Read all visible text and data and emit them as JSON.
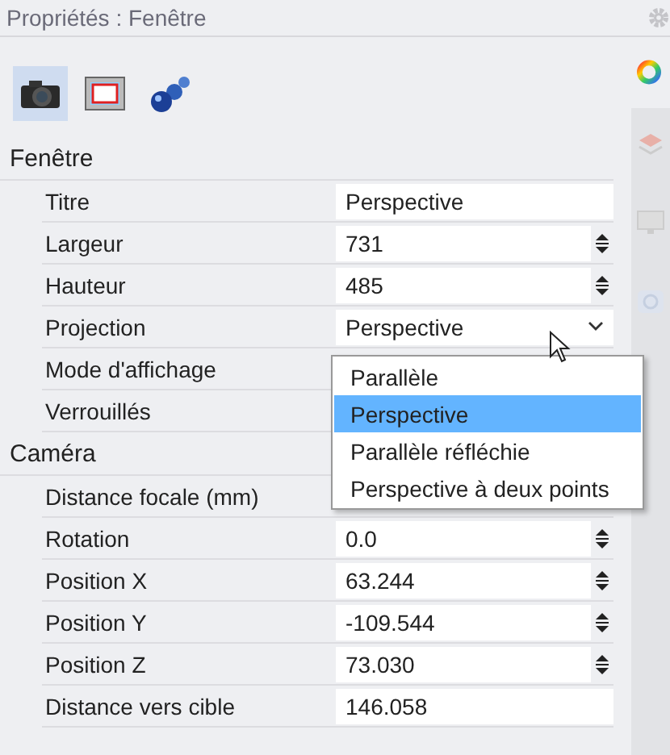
{
  "panel": {
    "title": "Propriétés : Fenêtre"
  },
  "toolbar": [
    {
      "kind": "camera",
      "selected": true
    },
    {
      "kind": "viewport",
      "selected": false
    },
    {
      "kind": "spheres",
      "selected": false
    }
  ],
  "sections": [
    {
      "title": "Fenêtre",
      "rows": [
        {
          "label": "Titre",
          "kind": "text",
          "value": "Perspective"
        },
        {
          "label": "Largeur",
          "kind": "spin",
          "value": "731"
        },
        {
          "label": "Hauteur",
          "kind": "spin",
          "value": "485"
        },
        {
          "label": "Projection",
          "kind": "dropdown",
          "value": "Perspective"
        },
        {
          "label": "Mode d'affichage",
          "kind": "hidden"
        },
        {
          "label": "Verrouillés",
          "kind": "hidden"
        }
      ]
    },
    {
      "title": "Caméra",
      "rows": [
        {
          "label": "Distance focale (mm)",
          "kind": "hidden"
        },
        {
          "label": "Rotation",
          "kind": "spin",
          "value": "0.0"
        },
        {
          "label": "Position X",
          "kind": "spin",
          "value": "63.244"
        },
        {
          "label": "Position Y",
          "kind": "spin",
          "value": "-109.544"
        },
        {
          "label": "Position Z",
          "kind": "spin",
          "value": "73.030"
        },
        {
          "label": "Distance vers cible",
          "kind": "text",
          "value": "146.058"
        }
      ]
    }
  ],
  "dropdown": {
    "options": [
      {
        "label": "Parallèle",
        "selected": false
      },
      {
        "label": "Perspective",
        "selected": true
      },
      {
        "label": "Parallèle réfléchie",
        "selected": false
      },
      {
        "label": "Perspective à deux points",
        "selected": false
      }
    ]
  }
}
